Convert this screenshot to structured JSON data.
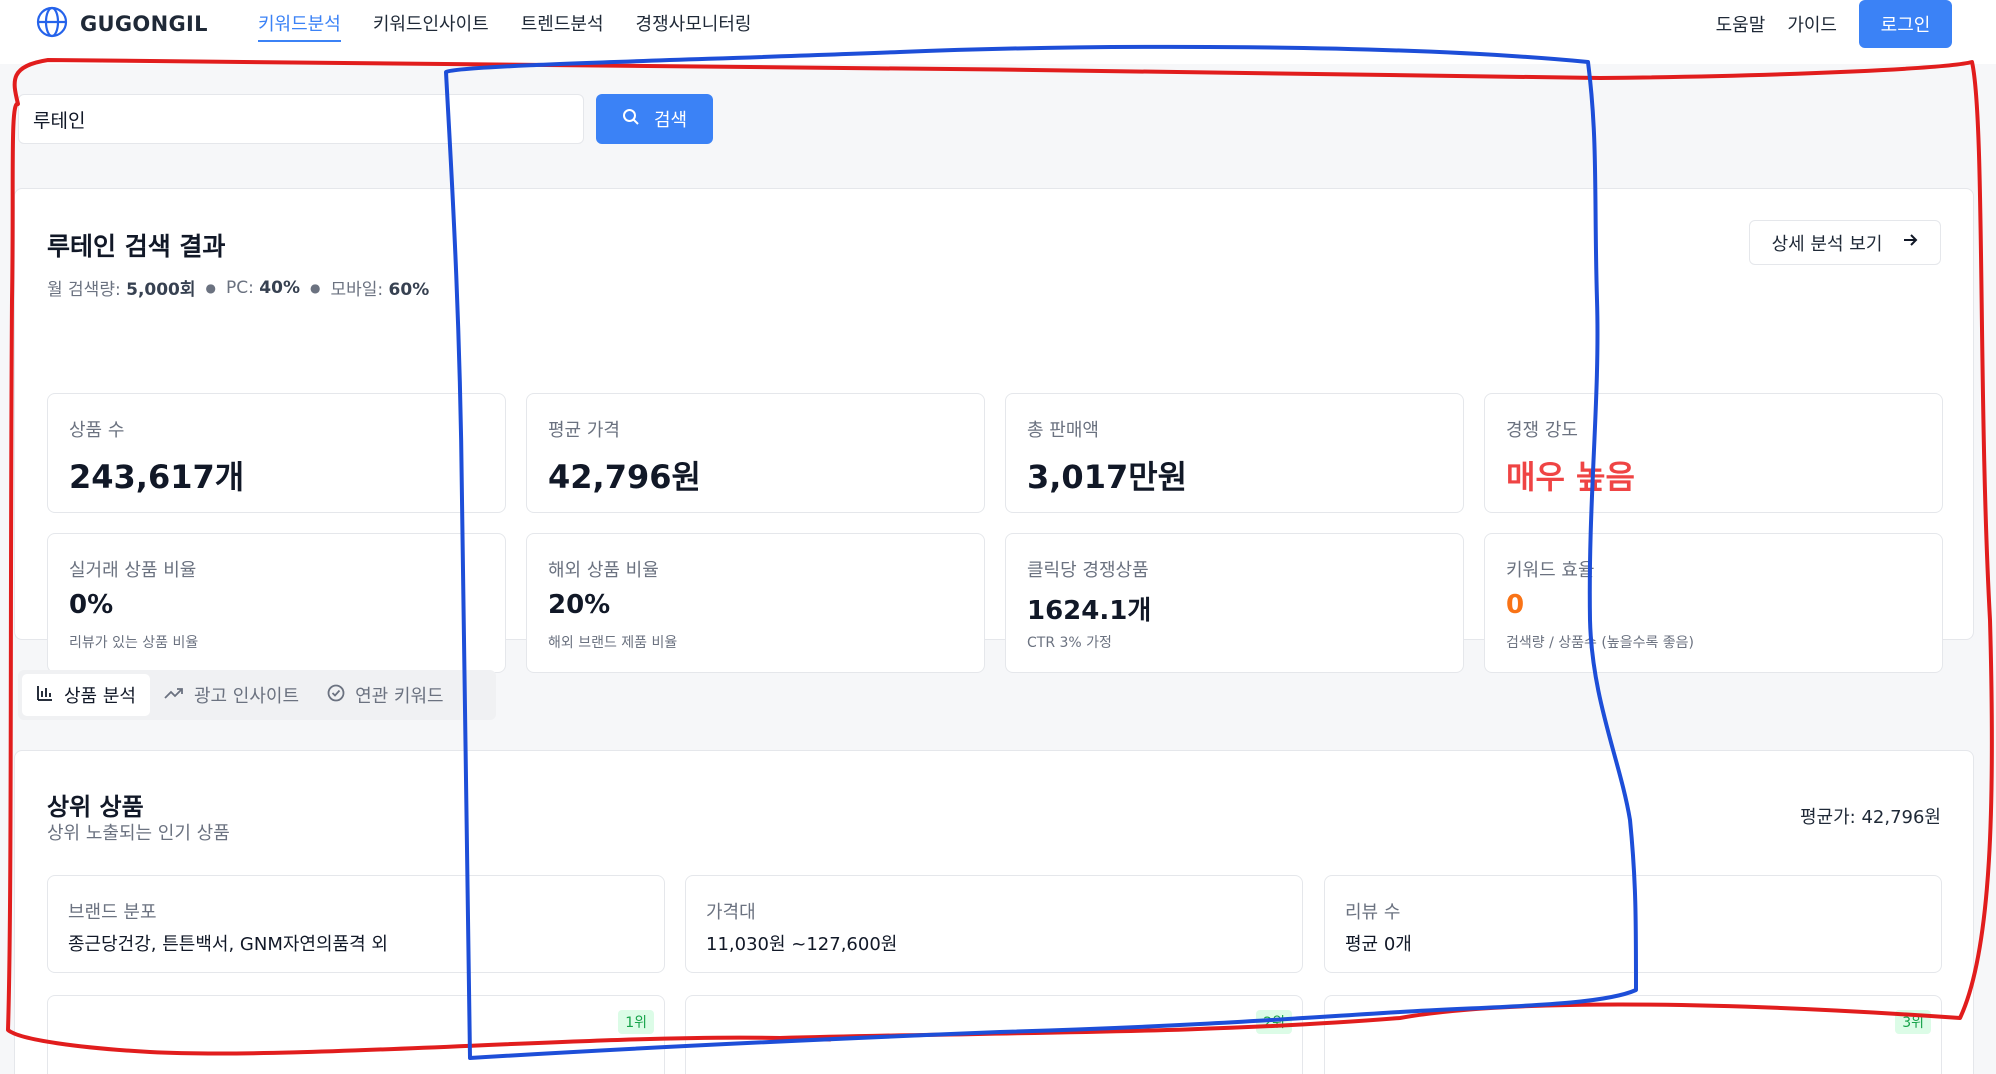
{
  "brand": {
    "name": "GUGONGIL",
    "icon": "globe-icon"
  },
  "nav": [
    {
      "label": "키워드분석",
      "active": true
    },
    {
      "label": "키워드인사이트",
      "active": false
    },
    {
      "label": "트렌드분석",
      "active": false
    },
    {
      "label": "경쟁사모니터링",
      "active": false
    }
  ],
  "header_right": {
    "help": "도움말",
    "guide": "가이드",
    "login": "로그인"
  },
  "search": {
    "value": "루테인",
    "button": "검색",
    "icon": "search-icon"
  },
  "result": {
    "title": "루테인 검색 결과",
    "monthly_label": "월 검색량:",
    "monthly_value": "5,000회",
    "pc_label": "PC:",
    "pc_value": "40%",
    "mobile_label": "모바일:",
    "mobile_value": "60%",
    "detail_button": "상세 분석 보기"
  },
  "stats": [
    {
      "label": "상품 수",
      "value": "243,617개"
    },
    {
      "label": "평균 가격",
      "value": "42,796원"
    },
    {
      "label": "총 판매액",
      "value": "3,017만원"
    },
    {
      "label": "경쟁 강도",
      "value": "매우 높음"
    },
    {
      "label": "실거래 상품 비율",
      "value": "0%",
      "note": "리뷰가 있는 상품 비율"
    },
    {
      "label": "해외 상품 비율",
      "value": "20%",
      "note": "해외 브랜드 제품 비율"
    },
    {
      "label": "클릭당 경쟁상품",
      "value": "1624.1개",
      "note": "CTR 3% 가정"
    },
    {
      "label": "키워드 효율",
      "value": "0",
      "note": "검색량 / 상품수 (높을수록 좋음)"
    }
  ],
  "colors": {
    "accent": "#3b82f6",
    "danger": "#ef4444",
    "warning": "#f97316",
    "annot_red": "#e11d1d",
    "annot_blue": "#1d4ed8"
  },
  "tabs": [
    {
      "label": "상품 분석",
      "icon": "bar-chart-icon",
      "active": true
    },
    {
      "label": "광고 인사이트",
      "icon": "trending-up-icon",
      "active": false
    },
    {
      "label": "연관 키워드",
      "icon": "check-circle-icon",
      "active": false
    }
  ],
  "products": {
    "title": "상위 상품",
    "subtitle": "상위 노출되는 인기 상품",
    "avg_price": "평균가: 42,796원",
    "info": [
      {
        "label": "브랜드 분포",
        "value": "종근당건강, 튼튼백서, GNM자연의품격 외"
      },
      {
        "label": "가격대",
        "value": "11,030원 ~127,600원"
      },
      {
        "label": "리뷰 수",
        "value": "평균 0개"
      }
    ],
    "ranks": [
      "1위",
      "2위",
      "3위"
    ]
  }
}
